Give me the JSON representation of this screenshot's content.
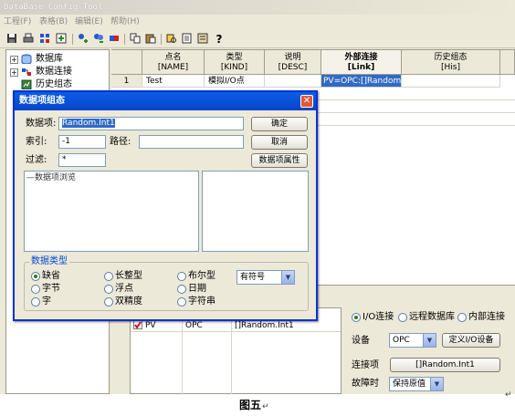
{
  "window": {
    "title": "DataBase Config Tool"
  },
  "menu": [
    "工程(F)",
    "表格(B)",
    "编辑(E)",
    "帮助(H)"
  ],
  "toolbar": {
    "icons": [
      "save-icon",
      "print-icon",
      "grid-icon",
      "import-icon",
      "add-tag-icon",
      "add-group-icon",
      "link-icon",
      "copy-icon",
      "paste-icon",
      "find-icon",
      "export-icon",
      "properties-icon",
      "help-icon"
    ],
    "help_glyph": "?"
  },
  "tree": {
    "items": [
      {
        "label": "数据库",
        "expander": "+"
      },
      {
        "label": "数据连接",
        "expander": "+"
      },
      {
        "label": "历史组态",
        "expander": ""
      }
    ]
  },
  "grid": {
    "columns": [
      {
        "name": "点名",
        "code": "[NAME]"
      },
      {
        "name": "类型",
        "code": "[KIND]"
      },
      {
        "name": "说明",
        "code": "[DESC]"
      },
      {
        "name": "外部连接",
        "code": "[Link]"
      },
      {
        "name": "历史组态",
        "code": "[His]"
      }
    ],
    "rows": [
      {
        "index": "1",
        "name": "Test",
        "kind": "模拟I/O点",
        "desc": "",
        "link": "PV=OPC:[]Random.Int",
        "his": ""
      }
    ]
  },
  "params": {
    "rows": [
      {
        "checked": true,
        "name": "PV",
        "source": "OPC",
        "item": "[]Random.Int1"
      }
    ]
  },
  "link_panel": {
    "conn_types": [
      "I/O连接",
      "远程数据库",
      "内部连接"
    ],
    "selected_conn": 0,
    "device_label": "设备",
    "device_value": "OPC",
    "define_button": "定义I/O设备",
    "item_label": "连接项",
    "item_value": "[]Random.Int1",
    "fault_label": "故障时",
    "fault_value": "保持原值"
  },
  "dialog": {
    "title": "数据项组态",
    "item_label": "数据项:",
    "item_value": "Random.Int1",
    "index_label": "索引:",
    "index_value": "-1",
    "path_label": "路径:",
    "path_value": "",
    "filter_label": "过滤:",
    "filter_value": "*",
    "ok_button": "确定",
    "cancel_button": "取消",
    "props_button": "数据项属性",
    "browse_label": "数据项浏览",
    "type_group_label": "数据类型",
    "types": [
      "缺省",
      "长整型",
      "布尔型",
      "字节",
      "浮点",
      "日期",
      "字",
      "双精度",
      "字符串"
    ],
    "selected_type": 0,
    "sign_value": "有符号"
  },
  "caption": {
    "text": "图五",
    "mark": "↵"
  },
  "colors": {
    "selection": "#316ac5",
    "title_blue": "#0a5fe6",
    "check_red": "#c8102e"
  }
}
